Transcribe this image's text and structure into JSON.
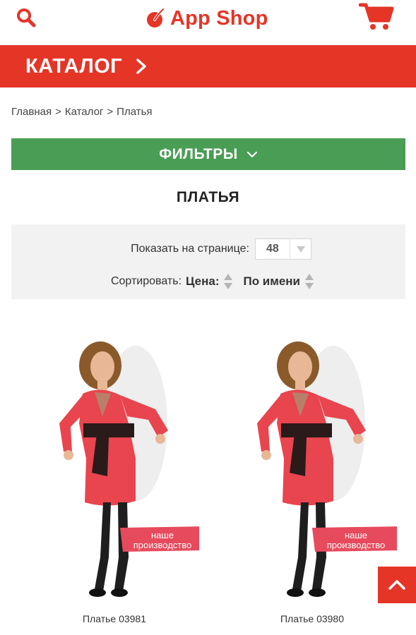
{
  "header": {
    "app_title": "App Shop",
    "icons": {
      "search": "search-icon",
      "cart": "cart-icon",
      "logo": "logo-mark-icon"
    }
  },
  "catalog_bar": {
    "label": "КАТАЛОГ",
    "icon": "chevron-right-icon"
  },
  "breadcrumb": {
    "items": [
      "Главная",
      "Каталог",
      "Платья"
    ],
    "separator": ">"
  },
  "filters": {
    "label": "ФИЛЬТРЫ",
    "icon": "chevron-down-icon"
  },
  "page_title": "ПЛАТЬЯ",
  "controls": {
    "per_page": {
      "label": "Показать на странице:",
      "value": "48"
    },
    "sort": {
      "label": "Сортировать:",
      "options": [
        "Цена:",
        "По имени"
      ]
    }
  },
  "products": [
    {
      "name": "Платье 03981",
      "badge": "наше производство"
    },
    {
      "name": "Платье 03980",
      "badge": "наше производство"
    }
  ],
  "colors": {
    "brand_red": "#e53527",
    "filters_green": "#4a9d55",
    "controls_bg": "#f2f2f2"
  }
}
